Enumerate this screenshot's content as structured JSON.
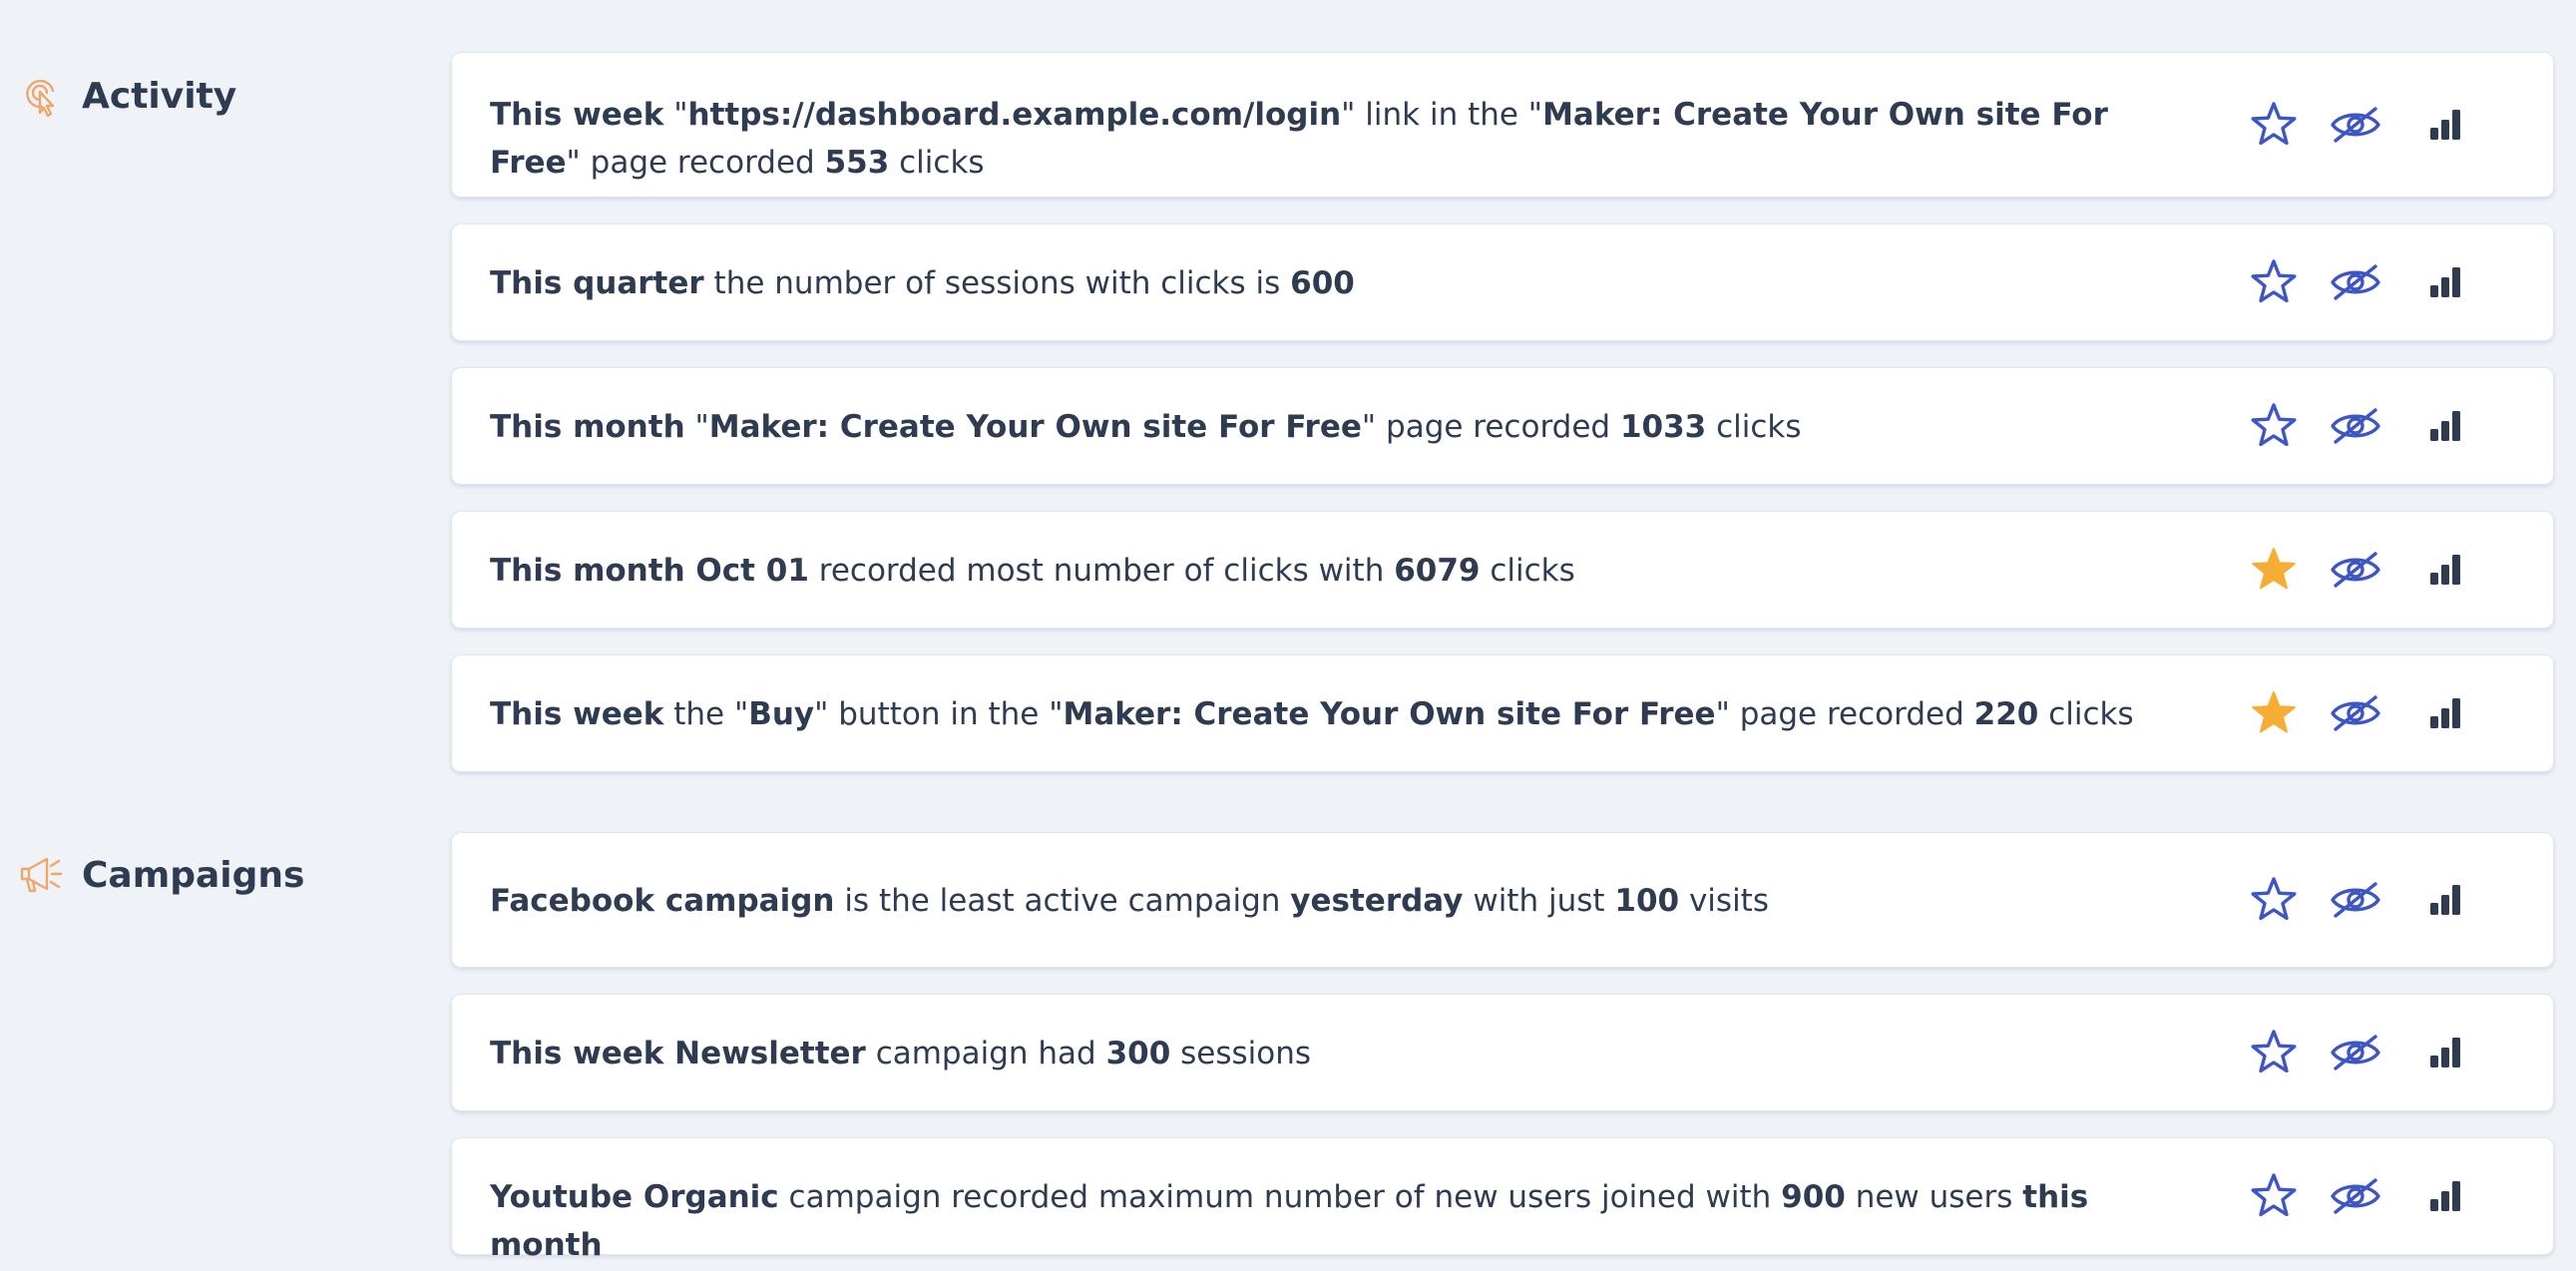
{
  "sections": {
    "activity": {
      "title": "Activity",
      "icon": "touch-click-icon"
    },
    "campaigns": {
      "title": "Campaigns",
      "icon": "megaphone-icon"
    }
  },
  "colors": {
    "background": "#eff3f8",
    "text": "#2e3b51",
    "accent_blue": "#3d56c4",
    "star_filled": "#f6ad36",
    "section_icon": "#eda76a",
    "chart_icon": "#2e3b51"
  },
  "cards": [
    {
      "starred": false,
      "parts": [
        {
          "t": "This week",
          "b": true
        },
        {
          "t": " \"",
          "b": false
        },
        {
          "t": "https://dashboard.example.com/login",
          "b": true
        },
        {
          "t": "\" link in the \"",
          "b": false
        },
        {
          "t": "Maker: Create Your Own site For Free",
          "b": true
        },
        {
          "t": "\" page recorded ",
          "b": false
        },
        {
          "t": "553",
          "b": true
        },
        {
          "t": " clicks",
          "b": false
        }
      ]
    },
    {
      "starred": false,
      "parts": [
        {
          "t": "This quarter",
          "b": true
        },
        {
          "t": " the number of sessions with clicks is ",
          "b": false
        },
        {
          "t": "600",
          "b": true
        }
      ]
    },
    {
      "starred": false,
      "parts": [
        {
          "t": "This month",
          "b": true
        },
        {
          "t": " \"",
          "b": false
        },
        {
          "t": "Maker: Create Your Own site For Free",
          "b": true
        },
        {
          "t": "\" page recorded ",
          "b": false
        },
        {
          "t": "1033",
          "b": true
        },
        {
          "t": " clicks",
          "b": false
        }
      ]
    },
    {
      "starred": true,
      "parts": [
        {
          "t": "This month Oct 01",
          "b": true
        },
        {
          "t": " recorded most number of clicks with ",
          "b": false
        },
        {
          "t": "6079",
          "b": true
        },
        {
          "t": " clicks",
          "b": false
        }
      ]
    },
    {
      "starred": true,
      "parts": [
        {
          "t": "This week",
          "b": true
        },
        {
          "t": " the \"",
          "b": false
        },
        {
          "t": "Buy",
          "b": true
        },
        {
          "t": "\" button in the \"",
          "b": false
        },
        {
          "t": "Maker: Create Your Own site For Free",
          "b": true
        },
        {
          "t": "\" page recorded ",
          "b": false
        },
        {
          "t": "220",
          "b": true
        },
        {
          "t": " clicks",
          "b": false
        }
      ]
    },
    {
      "starred": false,
      "parts": [
        {
          "t": "Facebook campaign",
          "b": true
        },
        {
          "t": " is the least active campaign ",
          "b": false
        },
        {
          "t": "yesterday",
          "b": true
        },
        {
          "t": " with just ",
          "b": false
        },
        {
          "t": "100",
          "b": true
        },
        {
          "t": " visits",
          "b": false
        }
      ]
    },
    {
      "starred": false,
      "parts": [
        {
          "t": "This week Newsletter",
          "b": true
        },
        {
          "t": " campaign had ",
          "b": false
        },
        {
          "t": "300",
          "b": true
        },
        {
          "t": " sessions",
          "b": false
        }
      ]
    },
    {
      "starred": false,
      "parts": [
        {
          "t": "Youtube Organic",
          "b": true
        },
        {
          "t": " campaign recorded maximum number of new users joined with ",
          "b": false
        },
        {
          "t": "900",
          "b": true
        },
        {
          "t": " new users ",
          "b": false
        },
        {
          "t": "this month",
          "b": true
        }
      ]
    }
  ],
  "action_icons": [
    "star-icon",
    "hide-eye-icon",
    "bar-chart-icon"
  ]
}
